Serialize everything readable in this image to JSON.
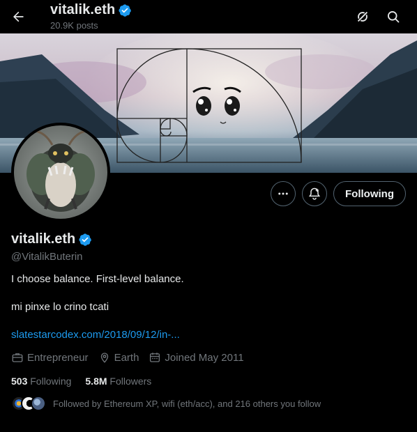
{
  "header": {
    "title": "vitalik.eth",
    "posts": "20.9K posts"
  },
  "actions": {
    "follow_label": "Following"
  },
  "profile": {
    "name": "vitalik.eth",
    "handle": "@VitalikButerin",
    "bio_line1": "I choose balance. First-level balance.",
    "bio_line2": "mi pinxe lo crino tcati",
    "link": "slatestarcodex.com/2018/09/12/in-...",
    "profession": "Entrepreneur",
    "location": "Earth",
    "joined": "Joined May 2011",
    "following_count": "503",
    "following_label": "Following",
    "followers_count": "5.8M",
    "followers_label": "Followers",
    "followed_by": "Followed by Ethereum XP, wifi (eth/acc), and 216 others you follow"
  },
  "colors": {
    "background": "#000000",
    "accent": "#1d9bf0",
    "secondary_text": "#71767b",
    "verified": "#1d9bf0"
  },
  "icons": [
    "back-arrow-icon",
    "verified-badge-icon",
    "grok-icon",
    "search-icon",
    "more-icon",
    "notification-bell-icon",
    "briefcase-icon",
    "location-pin-icon",
    "calendar-icon"
  ]
}
